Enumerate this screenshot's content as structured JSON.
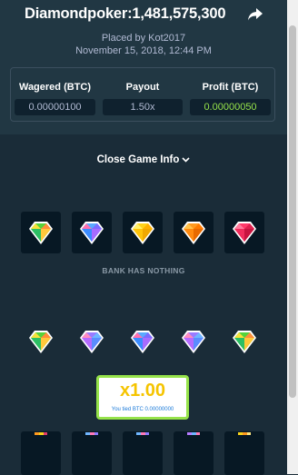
{
  "header": {
    "title": "Diamondpoker:1,481,575,300",
    "placed_by": "Placed by Kot2017",
    "date": "November 15, 2018, 12:44 PM"
  },
  "stats": {
    "wagered_label": "Wagered (BTC)",
    "wagered_value": "0.00000100",
    "payout_label": "Payout",
    "payout_value": "1.50x",
    "profit_label": "Profit (BTC)",
    "profit_value": "0.00000050",
    "profit_color": "#96e34a"
  },
  "toggle": {
    "label": "Close Game Info",
    "icon": "chevron-down-icon"
  },
  "bank": {
    "gems": [
      "green",
      "blue",
      "yellow",
      "orange",
      "red"
    ],
    "label": "BANK HAS NOTHING"
  },
  "player": {
    "gems": [
      "green",
      "purple",
      "blue",
      "purple",
      "green"
    ],
    "multiplier": "x1.00",
    "result_text": "You tied BTC 0.00000000"
  },
  "bottom_row": [
    "orange",
    "blue",
    "blue",
    "purple",
    "yellow"
  ],
  "colors": {
    "background": "#1a2c38",
    "panel": "#213743",
    "accent_green": "#96e34a",
    "multiplier_yellow": "#f5c400"
  }
}
